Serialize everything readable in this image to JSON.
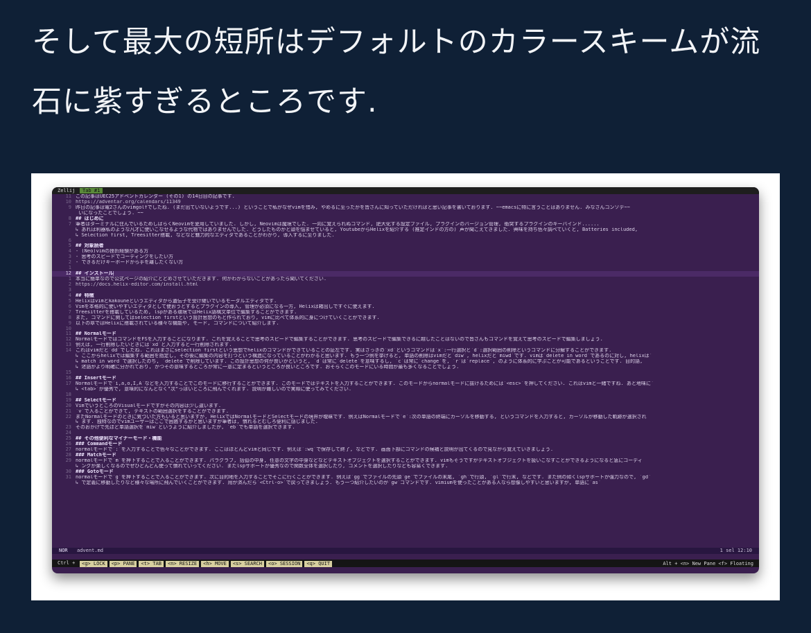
{
  "headline": {
    "line1": "そして最大の短所はデフォルトのカラースキームが流",
    "line2": "石に紫すぎるところです."
  },
  "terminal": {
    "app": "Zellij",
    "tab": "Tab #1",
    "lines": [
      {
        "n": "11",
        "t": "この記事はUEC25アドベントカレンダー (その1) の14日目の記事です.",
        "cls": ""
      },
      {
        "n": "10",
        "t": "https://adventar.org/calendars/11349",
        "cls": "link"
      },
      {
        "n": "9",
        "t": "昨日の記事は電2さんのvimgolfでしたね. (まだ出ていないようです...) ということで私がなぜvimを惜み, やめるに至ったかを皆さんに知っていただければと思い記事を書いております. ~~emacsに特に言うことはありません. みなさんコンソデ~~",
        "cls": ""
      },
      {
        "n": "",
        "t": "  いになったことでしょう. ~~",
        "cls": ""
      },
      {
        "n": "8",
        "t": "## はじめに",
        "cls": "h"
      },
      {
        "n": "7",
        "t": "筆者はターミナルに住んでいるためしばらくNeovimを愛用していました. しかし, Neovimは魔境でした. 一向に覚えられぬコマンド, 肥大化する設定ファイル, プラグインのバージョン管理, 衝突するプラグインのキーバインド......",
        "cls": ""
      },
      {
        "n": "",
        "t": "↳ あれは利器私のような凡才に使いこなせるような代物ではありませんでした. どうしたものかと頭を悩ませていると, YoutubeからHelixを紹介する (推定インドの方の) 声が聞こえてきました. 興味を持ち色々調べていくと, Batteries included,",
        "cls": ""
      },
      {
        "n": "",
        "t": "↳ Selection first, Treesitter搭載, などなど魅力的なエディタであることがわかり, 導入するに至りました.",
        "cls": ""
      },
      {
        "n": "6",
        "t": "",
        "cls": ""
      },
      {
        "n": "5",
        "t": "## 対象読者",
        "cls": "h"
      },
      {
        "n": "4",
        "t": "- (Neo)vimの挫折経験がある方",
        "cls": ""
      },
      {
        "n": "3",
        "t": "- 思考のスピードでコーディングをしたい方",
        "cls": ""
      },
      {
        "n": "2",
        "t": "- できるだけキーボードから手を離したくない方",
        "cls": ""
      },
      {
        "n": "1",
        "t": "",
        "cls": ""
      },
      {
        "n": "12",
        "t": "## インストール▏",
        "cls": "h cur"
      },
      {
        "n": "1",
        "t": "本当に簡単なので公式ページの紹介にとどめさせていただきます. 何かわからないことがあったら聞いてください.",
        "cls": ""
      },
      {
        "n": "2",
        "t": "https://docs.helix-editor.com/install.html",
        "cls": "link"
      },
      {
        "n": "3",
        "t": "",
        "cls": ""
      },
      {
        "n": "4",
        "t": "## 特徴",
        "cls": "h"
      },
      {
        "n": "5",
        "t": "Helixはvimとkakouneというエディタから遺伝子を受け継いでいるモーダルエディタです.",
        "cls": ""
      },
      {
        "n": "6",
        "t": "Vimを本格的に使いやすいエディタとして使おうとするとプラグインの導入, 管理が必須になる一方, Helixは箱出しですぐに使えます.",
        "cls": ""
      },
      {
        "n": "7",
        "t": "Treesitterを搭載しているため, lspがある環境ではHelix語構文単位で編集することができます.",
        "cls": ""
      },
      {
        "n": "8",
        "t": "また, コマンドに関してはselection firstという設計思想のもと作られており, vimに比べて体系的に身につけていくことができます.",
        "cls": ""
      },
      {
        "n": "9",
        "t": "以下の章ではHelixに搭載されている様々な機能や, モード, コマンドについて紹介します.",
        "cls": ""
      },
      {
        "n": "10",
        "t": "",
        "cls": ""
      },
      {
        "n": "11",
        "t": "## Normalモード",
        "cls": "h"
      },
      {
        "n": "12",
        "t": "NormalモードではコマンドをFSを入力することになります. これを覚えることで思考のスピードで編集することができます. 思考のスピードで編集できるに越したことはないので皆さんもコマンドを覚えて思考のスピードで編集しましょう.",
        "cls": ""
      },
      {
        "n": "13",
        "t": "例えば, 一行削除したいときには`xd`と入力すると一行削除されます.",
        "cls": ""
      },
      {
        "n": "14",
        "t": "これはvimだと`dd`でしたね. これはまさにselection firstという思想でhelixのコマンドができていることの証左です. 実はさっきの`xd`というコマンドは`x`:一行選択と`d`:選択範囲の削除というコマンドに分解することができます.",
        "cls": ""
      },
      {
        "n": "",
        "t": "↳ ここからhelixでは編集する範囲を指定し, その後に編集の内容を打つという構造になっていることがわかると思います. もう一つ例を挙げると, 単語の削除はvimだと`diw`, helixだと`miwd`です. vimは`delete in word`であるのに対し, helixは`",
        "cls": ""
      },
      {
        "n": "",
        "t": "↳ match in word`で選択したのち, `delete`で削除しています. この設計思想の何が良いかというと, `d`は常に`delete`を意味するし, `c`は常に`change`を, `r`は`replace`, のように体系的に学ぶことが可能であるということです. 目的語,",
        "cls": ""
      },
      {
        "n": "",
        "t": "↳ 述語がより明確に分かれており, かつその意味するところが常に一意に定まるというところが良いところです. おそらくこのモードにいる時間が最も多くなることでしょう.",
        "cls": ""
      },
      {
        "n": "15",
        "t": "",
        "cls": ""
      },
      {
        "n": "16",
        "t": "## Insertモード",
        "cls": "h"
      },
      {
        "n": "17",
        "t": "Normalモードで`i,a,o,I,A`などを入力することでこのモードに移行することができます. このモードではテキストを入力することができます. このモードからnormalモードに抜けるためには`<esc>`を押してください. これはvimと一緒ですね. あと地味に`",
        "cls": ""
      },
      {
        "n": "",
        "t": "↳ <tab>`が優秀で, 意味的になんとなく\"次\"っぽいところに飛んでくれます. 説明が難しいので実際に使ってみてください.",
        "cls": ""
      },
      {
        "n": "18",
        "t": "",
        "cls": ""
      },
      {
        "n": "19",
        "t": "## Selectモード",
        "cls": "h"
      },
      {
        "n": "20",
        "t": "VimでいうところのVisualモードですがその内容は少し違います.",
        "cls": ""
      },
      {
        "n": "21",
        "t": "`v`で入ることができて, テキストの範囲選択をすることができます.",
        "cls": ""
      },
      {
        "n": "22",
        "t": "またNormalモードのときに気づいた方もいると思いますが, HelixではNormalモードとSelectモードの境界が曖昧です. 例えばNormalモードで`e`:次の単語の終端にカーソルを移動する, というコマンドを入力すると, カーソルが移動した軌跡が選択され",
        "cls": ""
      },
      {
        "n": "",
        "t": "↳ ます. 独特なのでvimユーザーはここで困惑するかと思いますが筆者は, 慣れるとむしろ便利に感じました.",
        "cls": ""
      },
      {
        "n": "23",
        "t": "そのおかげで先ほど単語選択を`miw`というように紹介しましたが, `eb`でも単語を選択できます.",
        "cls": ""
      },
      {
        "n": "24",
        "t": "",
        "cls": ""
      },
      {
        "n": "25",
        "t": "## その他便利なマイナーモード・機能",
        "cls": "h"
      },
      {
        "n": "26",
        "t": "### Commandモード",
        "cls": "h"
      },
      {
        "n": "27",
        "t": "normalモードで`:`を入力することで色々なことができます. ここはほとんどvimと同じです. 例えば`:wq`で保存して終了, などです. 画面下部にコマンドの候補と説明が出てくるので見ながら覚えていきましょう.",
        "cls": ""
      },
      {
        "n": "28",
        "t": "### Matchモード",
        "cls": "h"
      },
      {
        "n": "29",
        "t": "normalモードで`m`を押下することで入ることができます. パラグラフ, 括弧の中身, 任意の文字の中身などなどテキストオブジェクトを選択することができます. vimもそうですがテキストオブジェクトを扱いこなすことができるようになると急にコーディ",
        "cls": ""
      },
      {
        "n": "",
        "t": "↳ ングが楽しくなるのでぜひどんどん使って慣れていってください. またlspサポートが優秀なので関数全体を選択したり, コメントを選択したりなども容易くできます.",
        "cls": ""
      },
      {
        "n": "30",
        "t": "### Gotoモード",
        "cls": "h"
      },
      {
        "n": "31",
        "t": "normalモードで`g`を押下することで入ることができます. 次に目的地を入力することでそこに行くことができます. 例えば`gg`でファイルの先頭`ge`でファイルの末尾, `gh`で行頭, `gl`で行末, などです. また例の如くlspサポートが強力なので, `gd`",
        "cls": ""
      },
      {
        "n": "",
        "t": "↳ で定義に移動したりなど様々な場所に飛んでいくことができます. 用が済んだら`<Ctrl-o>`で戻ってきましょう. もう一つ紹介したいのが`gw`コマンドです. vimiumを使ったことがある人なら想像しやすいと思いますが, 単語に`as`",
        "cls": ""
      }
    ],
    "status": {
      "mode": "NOR",
      "file": "advent.md",
      "right": "1 sel   12:10"
    },
    "zellij": {
      "lead": "Ctrl +",
      "keys": [
        "<g> LOCK",
        "<p> PANE",
        "<t> TAB",
        "<n> RESIZE",
        "<h> MOVE",
        "<s> SEARCH",
        "<o> SESSION",
        "<q> QUIT"
      ],
      "right": "Alt + <n> New Pane <f> Floating"
    }
  }
}
